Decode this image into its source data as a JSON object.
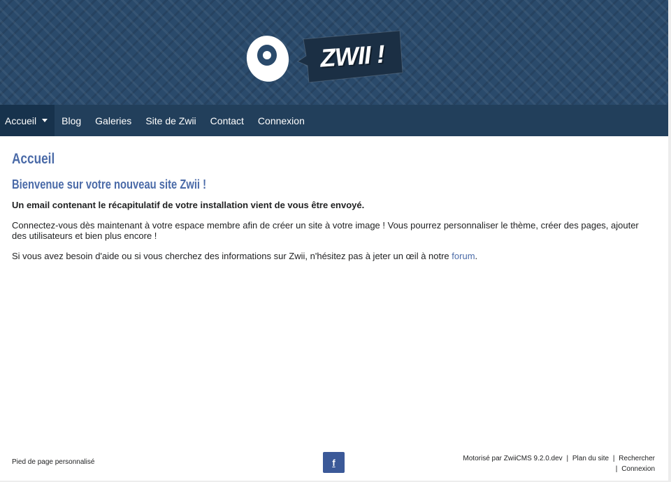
{
  "brand": {
    "logo_text": "ZWII !"
  },
  "nav": {
    "items": [
      {
        "label": "Accueil",
        "has_submenu": true,
        "active": true
      },
      {
        "label": "Blog"
      },
      {
        "label": "Galeries"
      },
      {
        "label": "Site de Zwii"
      },
      {
        "label": "Contact"
      },
      {
        "label": "Connexion"
      }
    ]
  },
  "main": {
    "page_title": "Accueil",
    "heading": "Bienvenue sur votre nouveau site Zwii !",
    "paragraph_bold": "Un email contenant le récapitulatif de votre installation vient de vous être envoyé.",
    "paragraph_1": "Connectez-vous dès maintenant à votre espace membre afin de créer un site à votre image ! Vous pourrez personnaliser le thème, créer des pages, ajouter des utilisateurs et bien plus encore !",
    "paragraph_2_prefix": "Si vous avez besoin d'aide ou si vous cherchez des informations sur Zwii, n'hésitez pas à jeter un œil à notre",
    "paragraph_2_link": "forum",
    "paragraph_2_suffix": "."
  },
  "footer": {
    "left_text": "Pied de page personnalisé",
    "social_icon": "facebook-icon",
    "social_label": "f",
    "powered_by": "Motorisé par ZwiiCMS 9.2.0.dev",
    "sitemap": "Plan du site",
    "search": "Rechercher",
    "login": "Connexion",
    "separator": "|"
  },
  "colors": {
    "banner": "#2a4a6b",
    "nav": "#223f5b",
    "nav_active": "#17324c",
    "accent": "#4b6ba8",
    "facebook": "#3b5998"
  }
}
